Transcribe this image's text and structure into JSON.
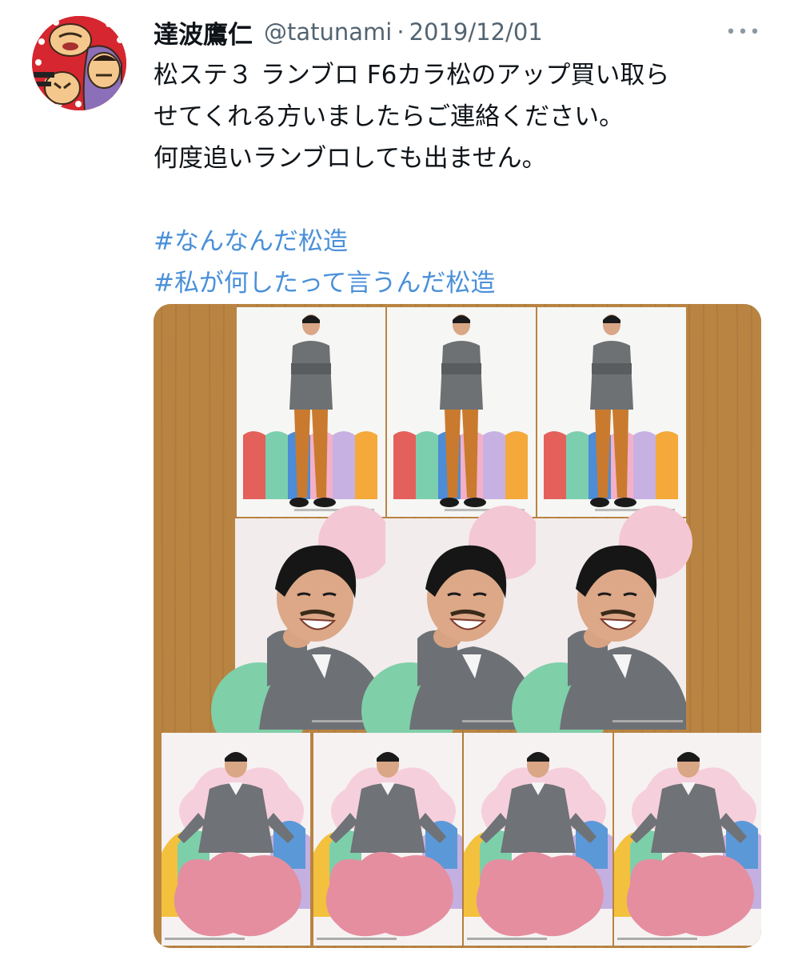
{
  "tweet": {
    "display_name": "達波鷹仁",
    "handle": "@tatunami",
    "separator": "·",
    "date": "2019/12/01",
    "more_icon": "more-dots-icon",
    "text_lines": [
      "松ステ３ ランブロ F6カラ松のアップ買い取ら",
      "せてくれる方いましたらご連絡ください。",
      "何度追いランブロしても出ません。"
    ],
    "hashtags": [
      "#なんなんだ松造",
      "#私が何したって言うんだ松造"
    ],
    "photo": {
      "card_rows": [
        3,
        3,
        4
      ],
      "row1_pose": "standing-arms-crossed",
      "row2_pose": "smiling-closeup",
      "row3_pose": "sitting-on-cloud-couch"
    },
    "colors": {
      "hashtag": "#4a90d9",
      "muted": "#536471",
      "table": "#b7803f"
    }
  }
}
